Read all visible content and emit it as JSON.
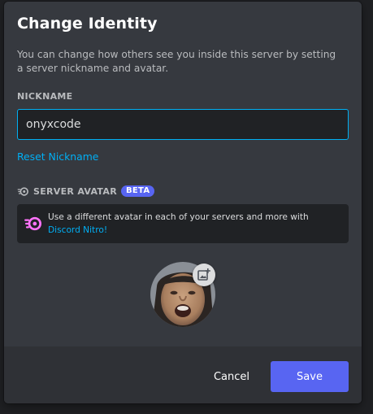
{
  "modal": {
    "title": "Change Identity",
    "description": "You can change how others see you inside this server by setting a server nickname and avatar."
  },
  "nickname": {
    "label": "NICKNAME",
    "value": "onyxcode",
    "reset_label": "Reset Nickname"
  },
  "server_avatar": {
    "label": "SERVER AVATAR",
    "badge": "BETA",
    "nitro_text": "Use a different avatar in each of your servers and more with ",
    "nitro_link": "Discord Nitro!",
    "nitro_icon": "nitro-icon",
    "edit_icon": "add-image-icon"
  },
  "footer": {
    "cancel_label": "Cancel",
    "save_label": "Save"
  },
  "colors": {
    "accent": "#5865f2",
    "link": "#00aff4",
    "nitro": "#ff73fa",
    "background": "#36393f",
    "footer": "#2f3136"
  }
}
